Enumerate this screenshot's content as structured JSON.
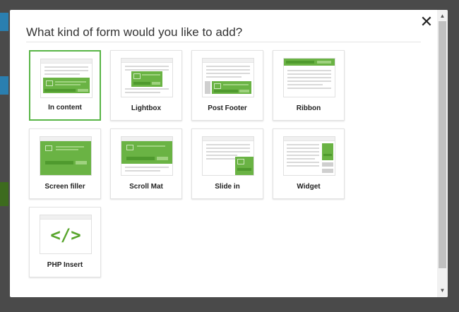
{
  "modal": {
    "title": "What kind of form would you like to add?",
    "close_label": "✕"
  },
  "form_types": [
    {
      "label": "In content",
      "selected": true
    },
    {
      "label": "Lightbox",
      "selected": false
    },
    {
      "label": "Post Footer",
      "selected": false
    },
    {
      "label": "Ribbon",
      "selected": false
    },
    {
      "label": "Screen filler",
      "selected": false
    },
    {
      "label": "Scroll Mat",
      "selected": false
    },
    {
      "label": "Slide in",
      "selected": false
    },
    {
      "label": "Widget",
      "selected": false
    },
    {
      "label": "PHP Insert",
      "selected": false
    }
  ],
  "php_icon": "</>",
  "colors": {
    "accent": "#6ab344",
    "selected_border": "#58b546",
    "backdrop": "#4a4a4a"
  }
}
